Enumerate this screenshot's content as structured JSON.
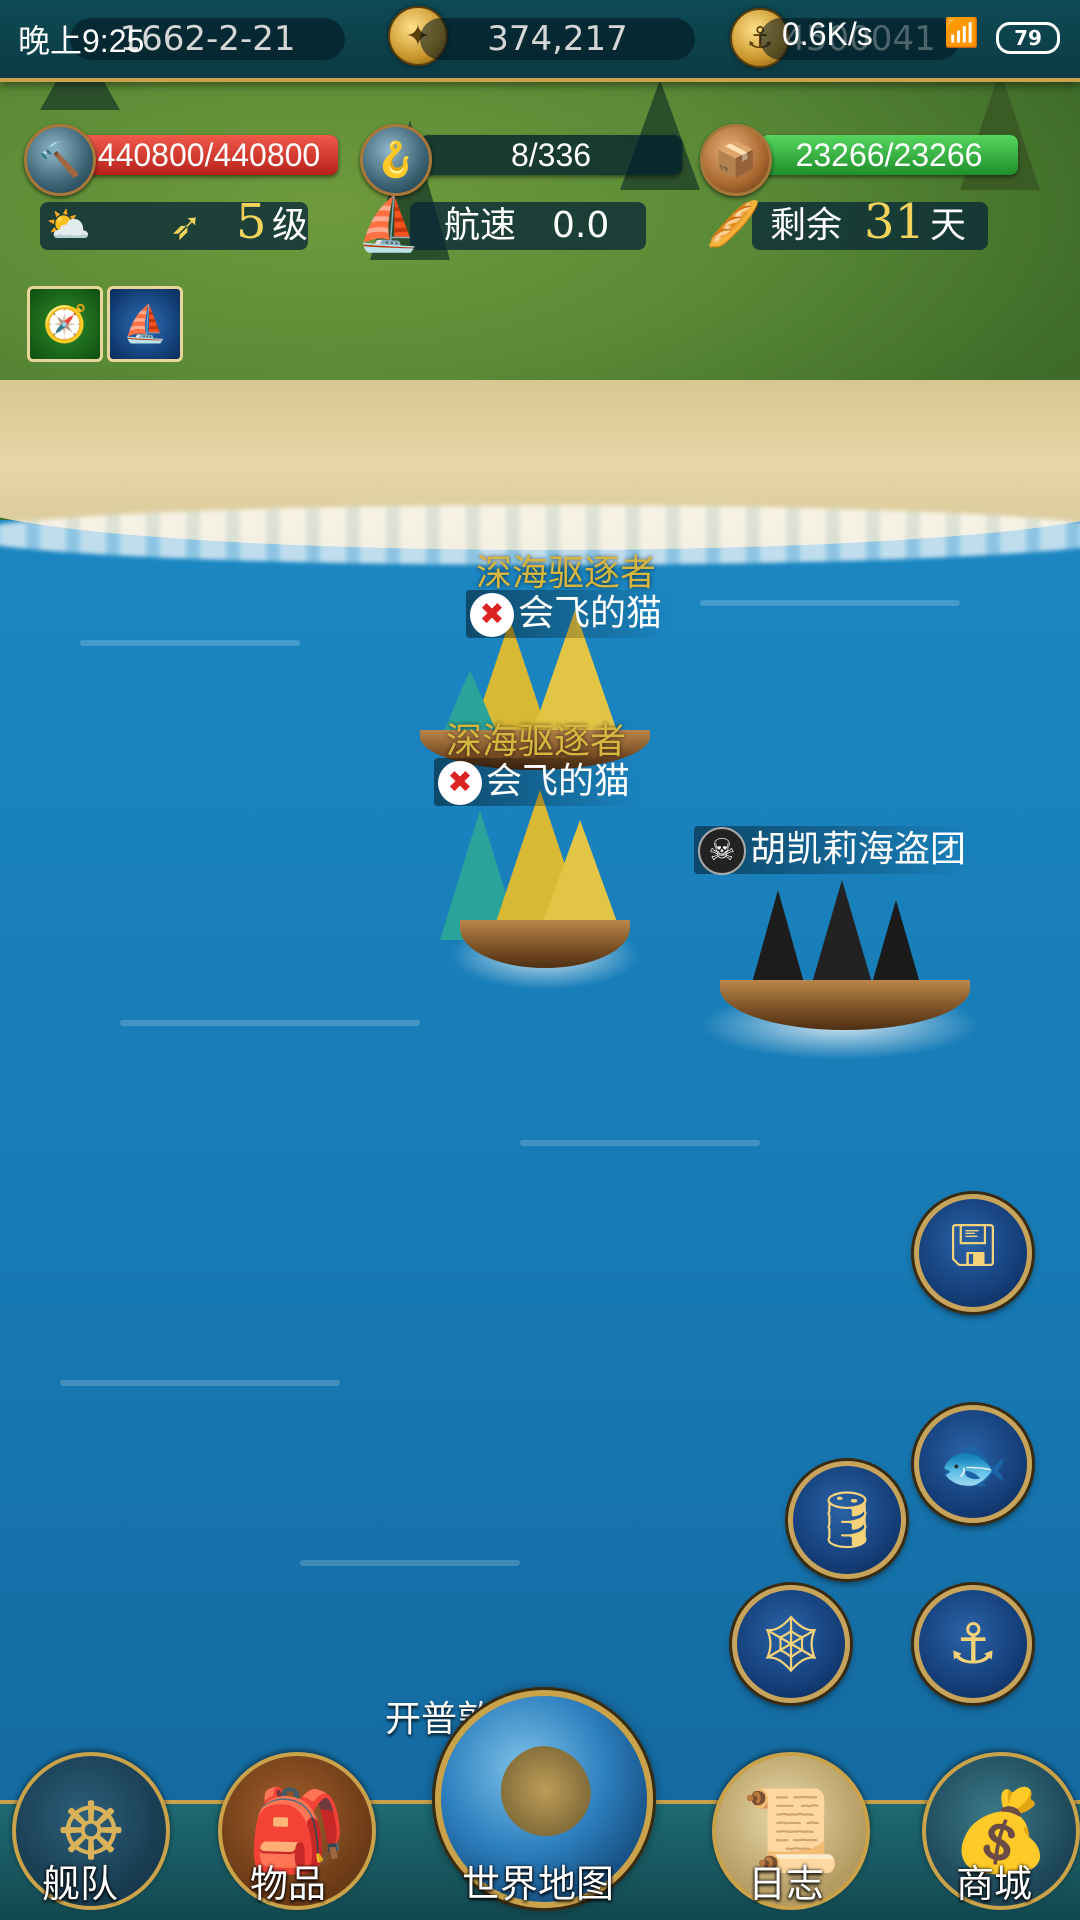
{
  "status_bar": {
    "time": "晚上9:25",
    "network": "0.6K/s",
    "battery": "79"
  },
  "top_bar": {
    "date": "1662-2-21",
    "coins": "374,217",
    "ingots": "4500041"
  },
  "resources": {
    "durability": "440800/440800",
    "crew": "8/336",
    "cargo": "23266/23266"
  },
  "stats": {
    "level_value": "5",
    "level_unit": "级",
    "speed_label": "航速",
    "speed_value": "0.0",
    "remain_label": "剩余",
    "remain_value": "31",
    "remain_unit": "天"
  },
  "buffs": [
    {
      "icon": "compass-speed-icon"
    },
    {
      "icon": "ship-fleet-icon"
    }
  ],
  "ships": [
    {
      "guild": "深海驱逐者",
      "name": "会飞的猫"
    },
    {
      "guild": "深海驱逐者",
      "name": "会飞的猫"
    },
    {
      "name": "胡凯莉海盗团"
    }
  ],
  "actions": [
    {
      "icon": "save-icon"
    },
    {
      "icon": "fish-icon"
    },
    {
      "icon": "barrel-icon"
    },
    {
      "icon": "net-icon"
    },
    {
      "icon": "anchor-icon"
    }
  ],
  "news_text": "开普敦海军队",
  "nav": {
    "fleet": "舰队",
    "items": "物品",
    "world_map": "世界地图",
    "log": "日志",
    "shop": "商城"
  },
  "colors": {
    "hp_bar": "#d9322a",
    "cargo_bar": "#2fae3c",
    "gold_text": "#f2d45c",
    "guild_text": "#d6b63e"
  }
}
